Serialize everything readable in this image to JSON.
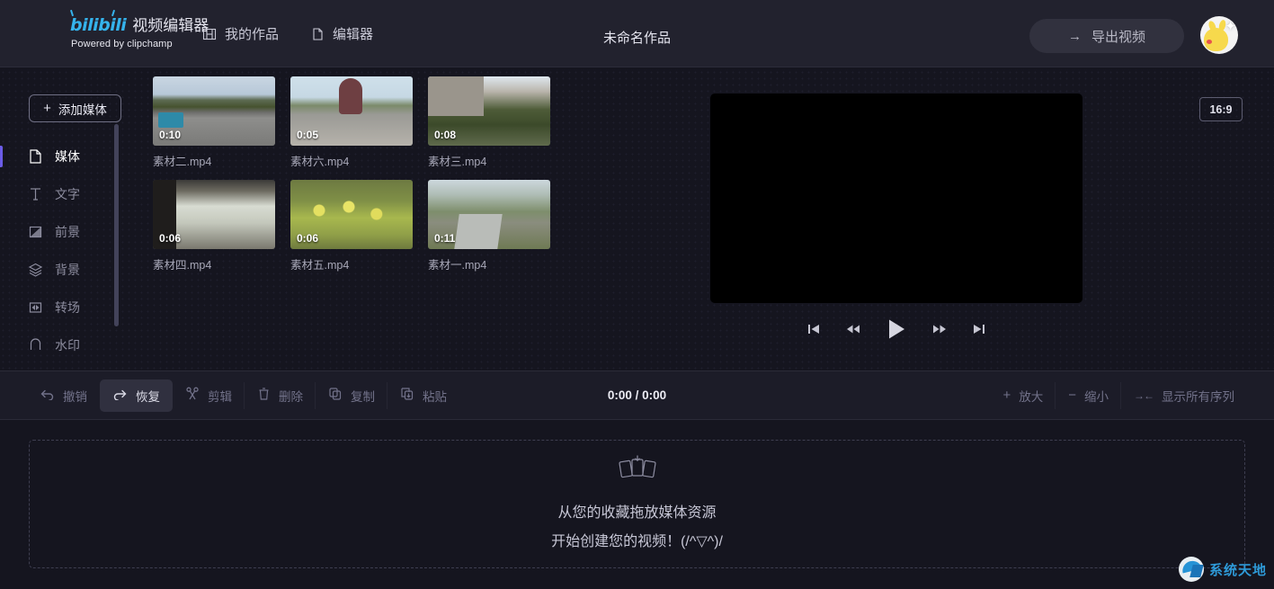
{
  "header": {
    "logo_text": "bilibili",
    "brand_title": "视频编辑器",
    "brand_sub": "Powered by clipchamp",
    "nav": [
      {
        "label": "我的作品",
        "icon": "filmstrip-icon"
      },
      {
        "label": "编辑器",
        "icon": "document-icon"
      }
    ],
    "project_title": "未命名作品",
    "export_label": "导出视频",
    "export_arrow": "→"
  },
  "sidebar": {
    "add_media_label": "添加媒体",
    "add_media_plus": "+",
    "items": [
      {
        "label": "媒体",
        "icon": "document-icon",
        "active": true
      },
      {
        "label": "文字",
        "icon": "text-icon",
        "active": false
      },
      {
        "label": "前景",
        "icon": "foreground-icon",
        "active": false
      },
      {
        "label": "背景",
        "icon": "layers-icon",
        "active": false
      },
      {
        "label": "转场",
        "icon": "transition-icon",
        "active": false
      },
      {
        "label": "水印",
        "icon": "watermark-icon",
        "active": false
      }
    ]
  },
  "media": {
    "items": [
      {
        "name": "素材二.mp4",
        "duration": "0:10",
        "art": "t1"
      },
      {
        "name": "素材六.mp4",
        "duration": "0:05",
        "art": "t2"
      },
      {
        "name": "素材三.mp4",
        "duration": "0:08",
        "art": "t3"
      },
      {
        "name": "素材四.mp4",
        "duration": "0:06",
        "art": "t4"
      },
      {
        "name": "素材五.mp4",
        "duration": "0:06",
        "art": "t5"
      },
      {
        "name": "素材一.mp4",
        "duration": "0:11",
        "art": "t6"
      }
    ]
  },
  "preview": {
    "aspect_ratio": "16:9",
    "controls": [
      {
        "name": "skip-to-start-icon"
      },
      {
        "name": "rewind-icon"
      },
      {
        "name": "play-icon"
      },
      {
        "name": "fast-forward-icon"
      },
      {
        "name": "skip-to-end-icon"
      }
    ]
  },
  "toolbar": {
    "undo_label": "撤销",
    "redo_label": "恢复",
    "trim_label": "剪辑",
    "delete_label": "删除",
    "copy_label": "复制",
    "paste_label": "粘贴",
    "time_display": "0:00 / 0:00",
    "zoom_in_label": "放大",
    "zoom_in_symbol": "+",
    "zoom_out_label": "缩小",
    "zoom_out_symbol": "−",
    "fit_all_label": "显示所有序列",
    "fit_all_symbol": "→←"
  },
  "timeline": {
    "empty_line1": "从您的收藏拖放媒体资源",
    "empty_line2": "开始创建您的视频！(/^▽^)/"
  },
  "watermark": {
    "text": "系统天地"
  },
  "colors": {
    "background": "#15151f",
    "header": "#22222e",
    "accent_purple": "#6b5ce7",
    "bili_blue": "#35b3ec",
    "watermark_blue": "#2e9ad8"
  }
}
